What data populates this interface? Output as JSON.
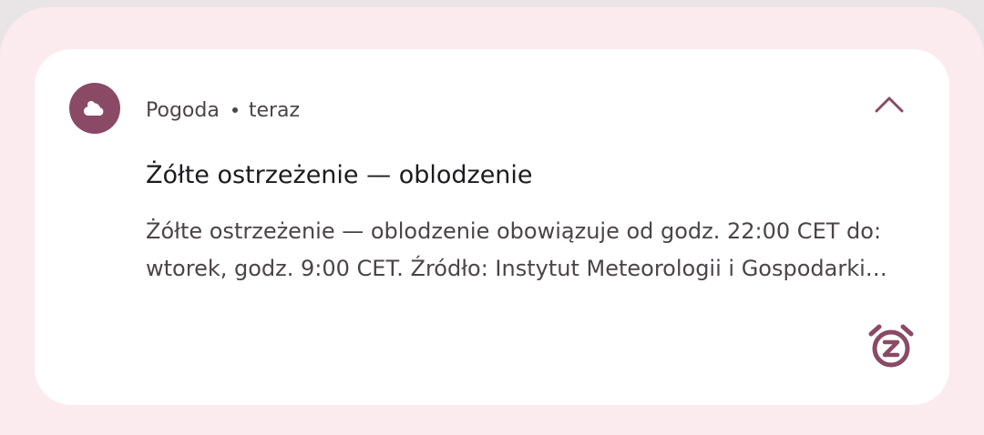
{
  "notification": {
    "app_name": "Pogoda",
    "separator": "•",
    "time": "teraz",
    "title": "Żółte ostrzeżenie — oblodzenie",
    "body": "Żółte ostrzeżenie — oblodzenie obowiązuje od godz. 22:00 CET do: wtorek, godz. 9:00 CET.  Źródło: Instytut Meteorologii i Gospodarki Wodnej",
    "app_icon": "weather-cloud-icon",
    "expand_icon": "chevron-up-icon",
    "snooze_icon": "snooze-alarm-icon"
  },
  "colors": {
    "accent": "#8a4a66",
    "shade_background": "#fbeaee",
    "card_background": "#ffffff",
    "primary_text": "#1d1b1e",
    "secondary_text": "#4b4448"
  }
}
